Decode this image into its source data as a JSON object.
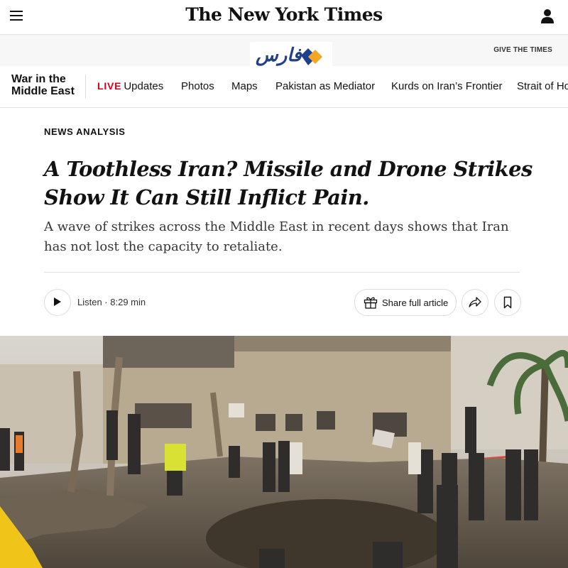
{
  "header": {
    "masthead": "The New York Times",
    "give_label": "GIVE THE TIMES"
  },
  "watermark": {
    "text": "فارس",
    "brand_colors": [
      "#1f3f8c",
      "#f5a623"
    ]
  },
  "section": {
    "title_line1": "War in the",
    "title_line2": "Middle East",
    "nav": {
      "live_label": "LIVE",
      "updates_label": "Updates",
      "items": [
        "Photos",
        "Maps",
        "Pakistan as Mediator",
        "Kurds on Iran’s Frontier",
        "Strait of Ho"
      ]
    }
  },
  "article": {
    "kicker": "NEWS ANALYSIS",
    "headline": "A Toothless Iran? Missile and Drone Strikes Show It Can Still Inflict Pain.",
    "summary": "A wave of strikes across the Middle East in recent days shows that Iran has not lost the capacity to retaliate.",
    "listen_label": "Listen · 8:29 min",
    "share_label": "Share full article"
  },
  "colors": {
    "live_red": "#d0021b",
    "text": "#121212",
    "police_tape": "#e8453c"
  },
  "icons": [
    "menu-icon",
    "account-icon",
    "play-icon",
    "gift-icon",
    "share-arrow-icon",
    "bookmark-icon"
  ]
}
